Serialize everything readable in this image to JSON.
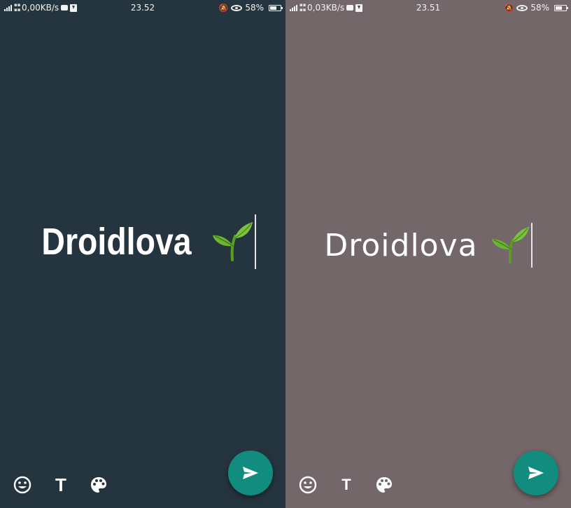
{
  "left": {
    "background": "#25353F",
    "status": {
      "network_speed": "0,00KB/s",
      "time": "23.52",
      "battery": "58%"
    },
    "status_text": "Droidlova",
    "font_style": "bold-condensed"
  },
  "right": {
    "background": "#746769",
    "status": {
      "network_speed": "0,03KB/s",
      "time": "23.51",
      "battery": "58%"
    },
    "status_text": "Droidlova",
    "font_style": "handwriting"
  },
  "toolbar": {
    "emoji_icon": "emoji-icon",
    "text_style_icon": "text-style-icon",
    "color_icon": "palette-icon"
  },
  "send": {
    "icon": "send-icon",
    "color": "#128C7E"
  },
  "emoji": {
    "name": "seedling-icon"
  }
}
